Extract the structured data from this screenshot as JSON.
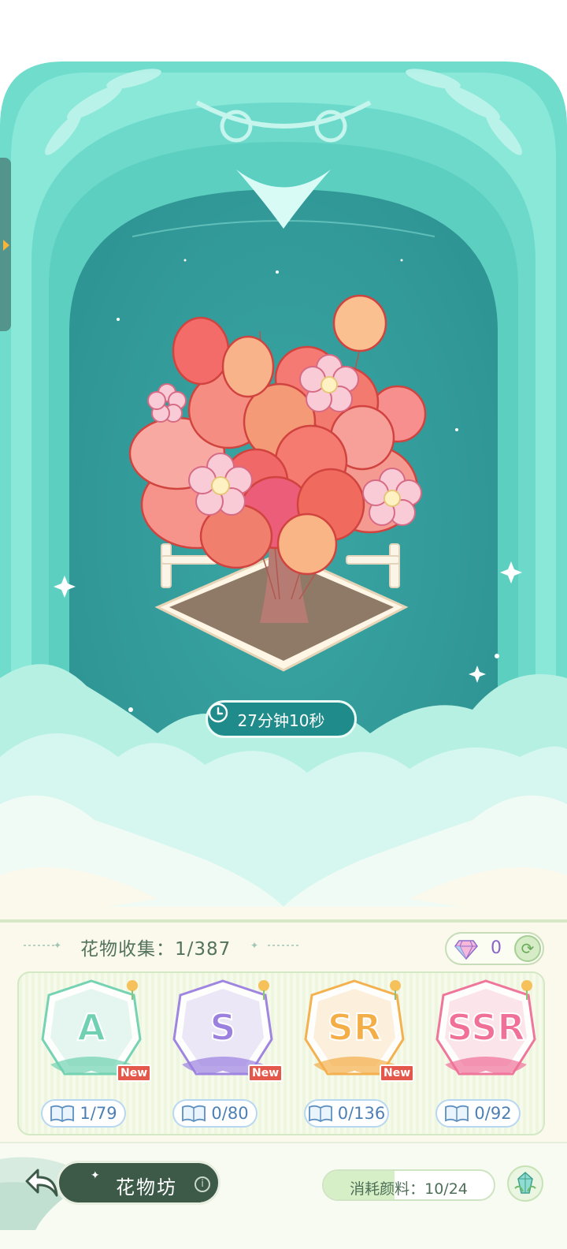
{
  "timer": {
    "text": "27分钟10秒",
    "icon": "clock-icon"
  },
  "side_handle": {
    "icon": "chevron-right-icon"
  },
  "collection": {
    "title": "花物收集：1/387"
  },
  "currency": {
    "icon": "diamond-icon",
    "value": "0",
    "refresh_icon": "refresh-icon"
  },
  "tiers": [
    {
      "tier": "A",
      "count": "1/79",
      "new": "New",
      "color": "#6fd1b1"
    },
    {
      "tier": "S",
      "count": "0/80",
      "new": "New",
      "color": "#9b80e0"
    },
    {
      "tier": "SR",
      "count": "0/136",
      "new": "New",
      "color": "#f4ae48"
    },
    {
      "tier": "SSR",
      "count": "0/92",
      "new": "",
      "color": "#f07098"
    }
  ],
  "bottom": {
    "back_icon": "back-arrow-icon",
    "workshop_name": "花物坊",
    "info_icon": "i",
    "consume_label": "消耗颜料：10/24",
    "consume_progress": 0.4167,
    "crystal_icon": "crystal-icon"
  },
  "colors": {
    "teal": "#5ecbbf",
    "deep_teal": "#2f9c9a",
    "panel": "#fbf8ec",
    "accent_text": "#53735d"
  }
}
